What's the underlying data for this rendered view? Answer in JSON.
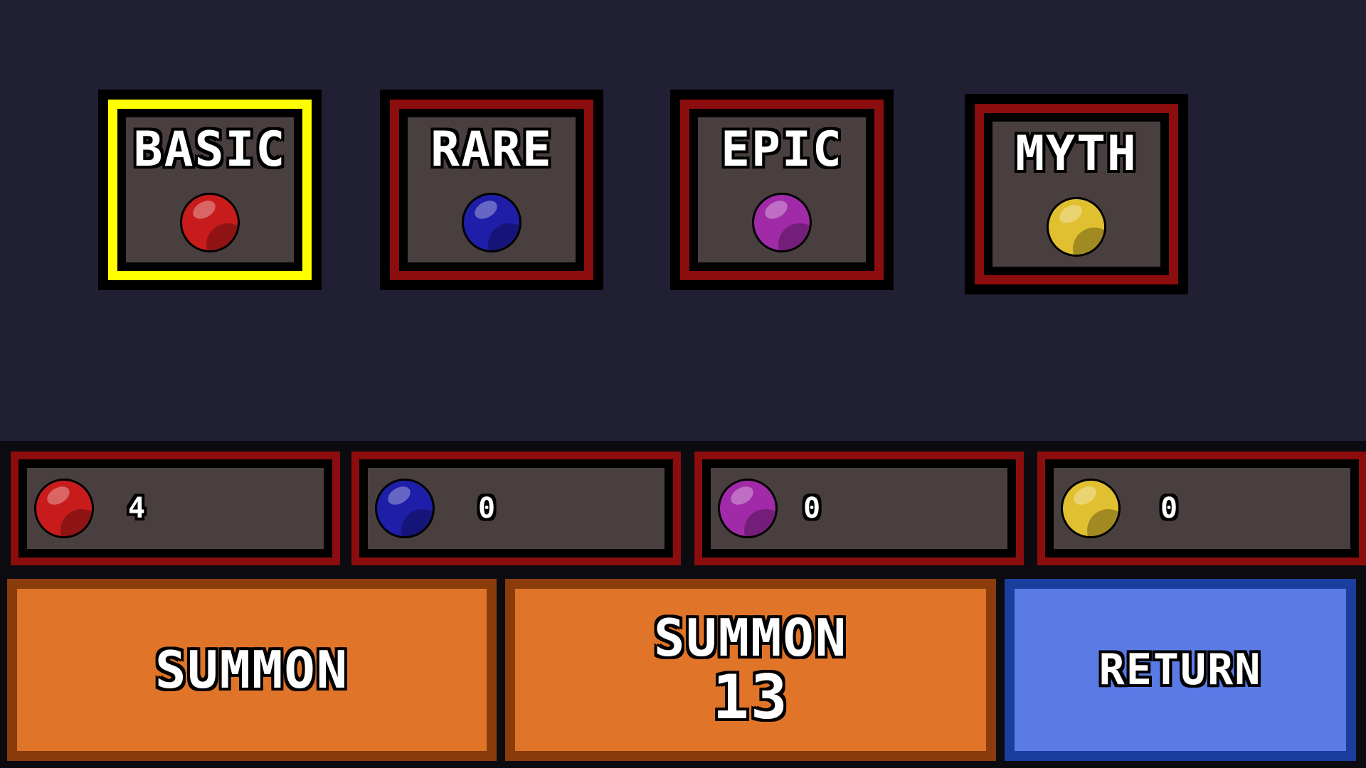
{
  "colors": {
    "selected_frame": "#ffff00",
    "frame": "#8b0d0d",
    "panel": "#4a3f3f",
    "background": "#211f33",
    "summon_button": "#e07428",
    "return_button": "#5a7ae6"
  },
  "tiers": [
    {
      "label": "BASIC",
      "orb_color": "#c81c1c",
      "selected": true
    },
    {
      "label": "RARE",
      "orb_color": "#1e1ea8",
      "selected": false
    },
    {
      "label": "EPIC",
      "orb_color": "#a02aa8",
      "selected": false
    },
    {
      "label": "MYTH",
      "orb_color": "#e0c030",
      "selected": false
    }
  ],
  "currency": [
    {
      "orb_color": "#c81c1c",
      "count": "4"
    },
    {
      "orb_color": "#1e1ea8",
      "count": "0"
    },
    {
      "orb_color": "#a02aa8",
      "count": "0"
    },
    {
      "orb_color": "#e0c030",
      "count": "0"
    }
  ],
  "actions": {
    "summon_label": "SUMMON",
    "summon_multi_label": "SUMMON",
    "summon_multi_count": "13",
    "return_label": "RETURN"
  }
}
